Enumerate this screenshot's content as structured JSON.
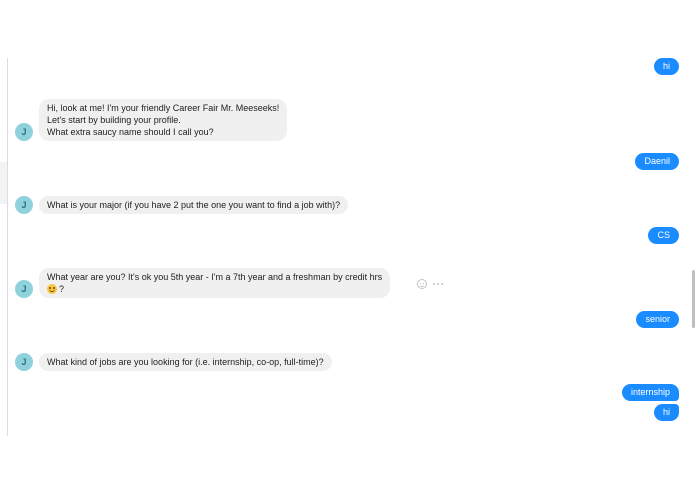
{
  "conversation": {
    "bot_avatar_initial": "J",
    "messages": [
      {
        "id": "m1",
        "sender": "user",
        "lines": [
          "hi"
        ]
      },
      {
        "id": "m2",
        "sender": "bot",
        "lines": [
          "Hi, look at me! I'm your friendly Career Fair Mr. Meeseeks!",
          "Let's start by building your profile.",
          "What extra saucy name should I call you?"
        ]
      },
      {
        "id": "m3",
        "sender": "user",
        "lines": [
          "Daenil"
        ]
      },
      {
        "id": "m4",
        "sender": "bot",
        "lines": [
          "What is your major (if you have 2 put the one you want to find a job with)?"
        ]
      },
      {
        "id": "m5",
        "sender": "user",
        "lines": [
          "CS"
        ]
      },
      {
        "id": "m6",
        "sender": "bot",
        "lines": [
          "What year are you? It's ok you 5th year - I'm a 7th year and a freshman by credit hrs",
          "?"
        ],
        "emoji": "smiling-face-emoji"
      },
      {
        "id": "m7",
        "sender": "user",
        "lines": [
          "senior"
        ]
      },
      {
        "id": "m8",
        "sender": "bot",
        "lines": [
          "What kind of jobs are you looking for (i.e. internship, co-op, full-time)?"
        ]
      },
      {
        "id": "m9",
        "sender": "user",
        "lines": [
          "internship"
        ]
      },
      {
        "id": "m10",
        "sender": "user",
        "lines": [
          "hi"
        ]
      }
    ]
  },
  "message_actions": {
    "react_icon": "smiley-react-icon",
    "more_icon": "more-options-icon"
  },
  "colors": {
    "outgoing_bubble": "#1a8cff",
    "incoming_bubble": "#f1f0f0",
    "avatar": "#8fd2dc"
  }
}
